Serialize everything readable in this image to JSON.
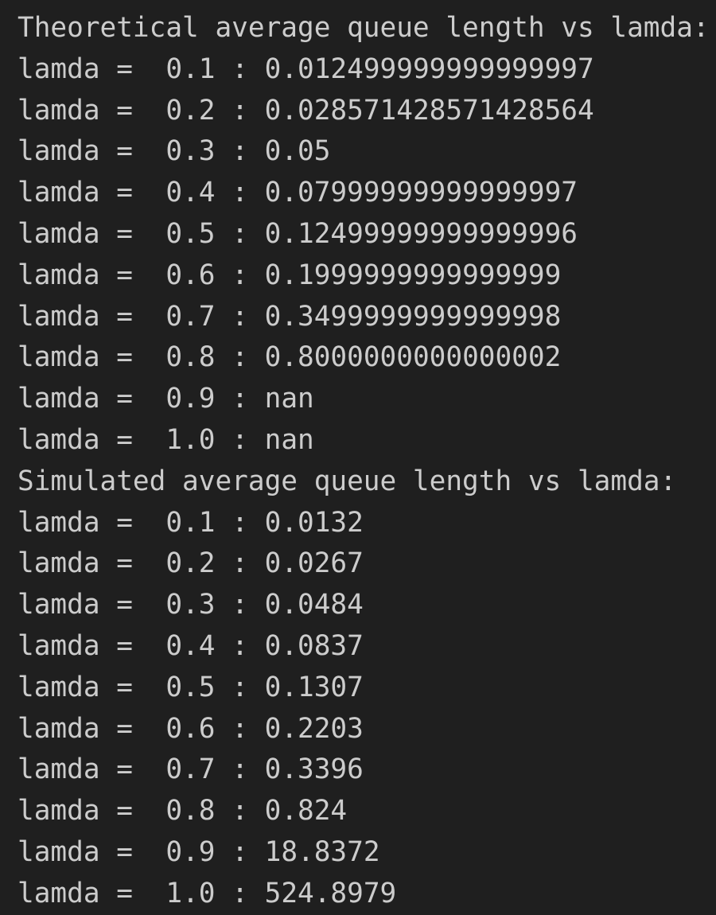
{
  "theoretical": {
    "header": "Theoretical average queue length vs lamda:",
    "rows": [
      {
        "lamda": "0.1",
        "value": "0.012499999999999997"
      },
      {
        "lamda": "0.2",
        "value": "0.028571428571428564"
      },
      {
        "lamda": "0.3",
        "value": "0.05"
      },
      {
        "lamda": "0.4",
        "value": "0.07999999999999997"
      },
      {
        "lamda": "0.5",
        "value": "0.12499999999999996"
      },
      {
        "lamda": "0.6",
        "value": "0.1999999999999999"
      },
      {
        "lamda": "0.7",
        "value": "0.3499999999999998"
      },
      {
        "lamda": "0.8",
        "value": "0.8000000000000002"
      },
      {
        "lamda": "0.9",
        "value": "nan"
      },
      {
        "lamda": "1.0",
        "value": "nan"
      }
    ]
  },
  "simulated": {
    "header": "Simulated average queue length vs lamda:",
    "rows": [
      {
        "lamda": "0.1",
        "value": "0.0132"
      },
      {
        "lamda": "0.2",
        "value": "0.0267"
      },
      {
        "lamda": "0.3",
        "value": "0.0484"
      },
      {
        "lamda": "0.4",
        "value": "0.0837"
      },
      {
        "lamda": "0.5",
        "value": "0.1307"
      },
      {
        "lamda": "0.6",
        "value": "0.2203"
      },
      {
        "lamda": "0.7",
        "value": "0.3396"
      },
      {
        "lamda": "0.8",
        "value": "0.824"
      },
      {
        "lamda": "0.9",
        "value": "18.8372"
      },
      {
        "lamda": "1.0",
        "value": "524.8979"
      }
    ]
  },
  "row_prefix": "lamda = ",
  "separator": " : "
}
